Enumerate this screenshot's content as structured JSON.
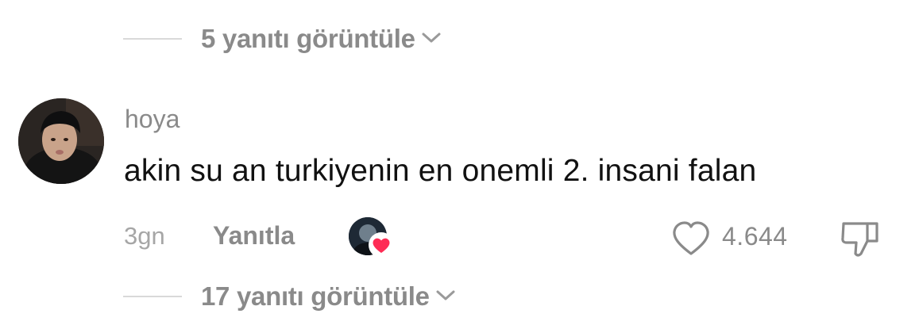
{
  "replies_top": {
    "label": "5 yanıtı görüntüle"
  },
  "comment": {
    "username": "hoya",
    "text": "akin su an turkiyenin en onemli 2. insani falan",
    "time": "3gn",
    "reply_label": "Yanıtla",
    "like_count": "4.644"
  },
  "replies_bottom": {
    "label": "17 yanıtı görüntüle"
  },
  "colors": {
    "muted": "#8a8a8a",
    "text": "#111111",
    "heart_accent": "#fe2c55"
  },
  "icons": [
    "chevron-down-icon",
    "heart-outline-icon",
    "dislike-icon",
    "creator-heart-icon"
  ]
}
